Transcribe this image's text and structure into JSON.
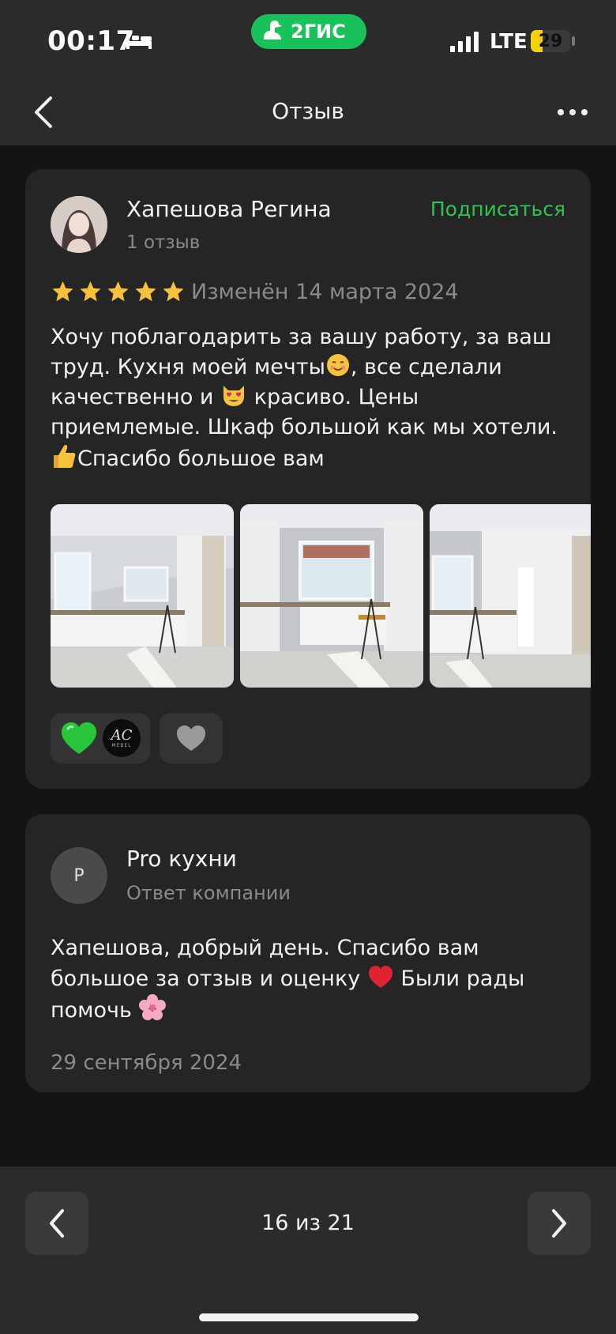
{
  "status_bar": {
    "time": "00:17",
    "brand": "2ГИС",
    "network": "LTE",
    "battery": "29",
    "battery_level": 0.29
  },
  "header": {
    "title": "Отзыв",
    "back_icon": "chevron-left-icon",
    "more_icon": "more-dots-icon"
  },
  "review": {
    "author": "Хапешова Регина",
    "review_count": "1 отзыв",
    "subscribe_label": "Подписаться",
    "rating": 5,
    "date": "Изменён 14 марта 2024",
    "text_parts": [
      "Хочу поблагодарить за вашу работу, за ваш труд. Кухня моей мечты",
      ", все сделали качественно и ",
      " красиво. Цены приемлемые. Шкаф большой как мы хотели. ",
      "Спасибо большое вам"
    ],
    "photos": [
      "kitchen-photo-1",
      "kitchen-photo-2",
      "kitchen-photo-3"
    ],
    "reactions": {
      "icons": [
        "green-heart-icon",
        "ac-mebel-logo"
      ],
      "logo_text": "AC",
      "logo_sub": "MEBEL",
      "like_icon": "heart-icon"
    }
  },
  "reply": {
    "avatar_letter": "P",
    "company": "Pro кухни",
    "label": "Ответ компании",
    "text_parts": [
      "Хапешова, добрый день. Спасибо вам большое за отзыв и оценку ",
      " Были рады помочь "
    ],
    "date": "29 сентября 2024"
  },
  "pager": {
    "label": "16 из 21",
    "prev_icon": "chevron-left-icon",
    "next_icon": "chevron-right-icon"
  },
  "colors": {
    "accent_green": "#2ec653",
    "brand_green": "#19c15a",
    "star": "#f7c23a",
    "card_bg": "#252525"
  }
}
